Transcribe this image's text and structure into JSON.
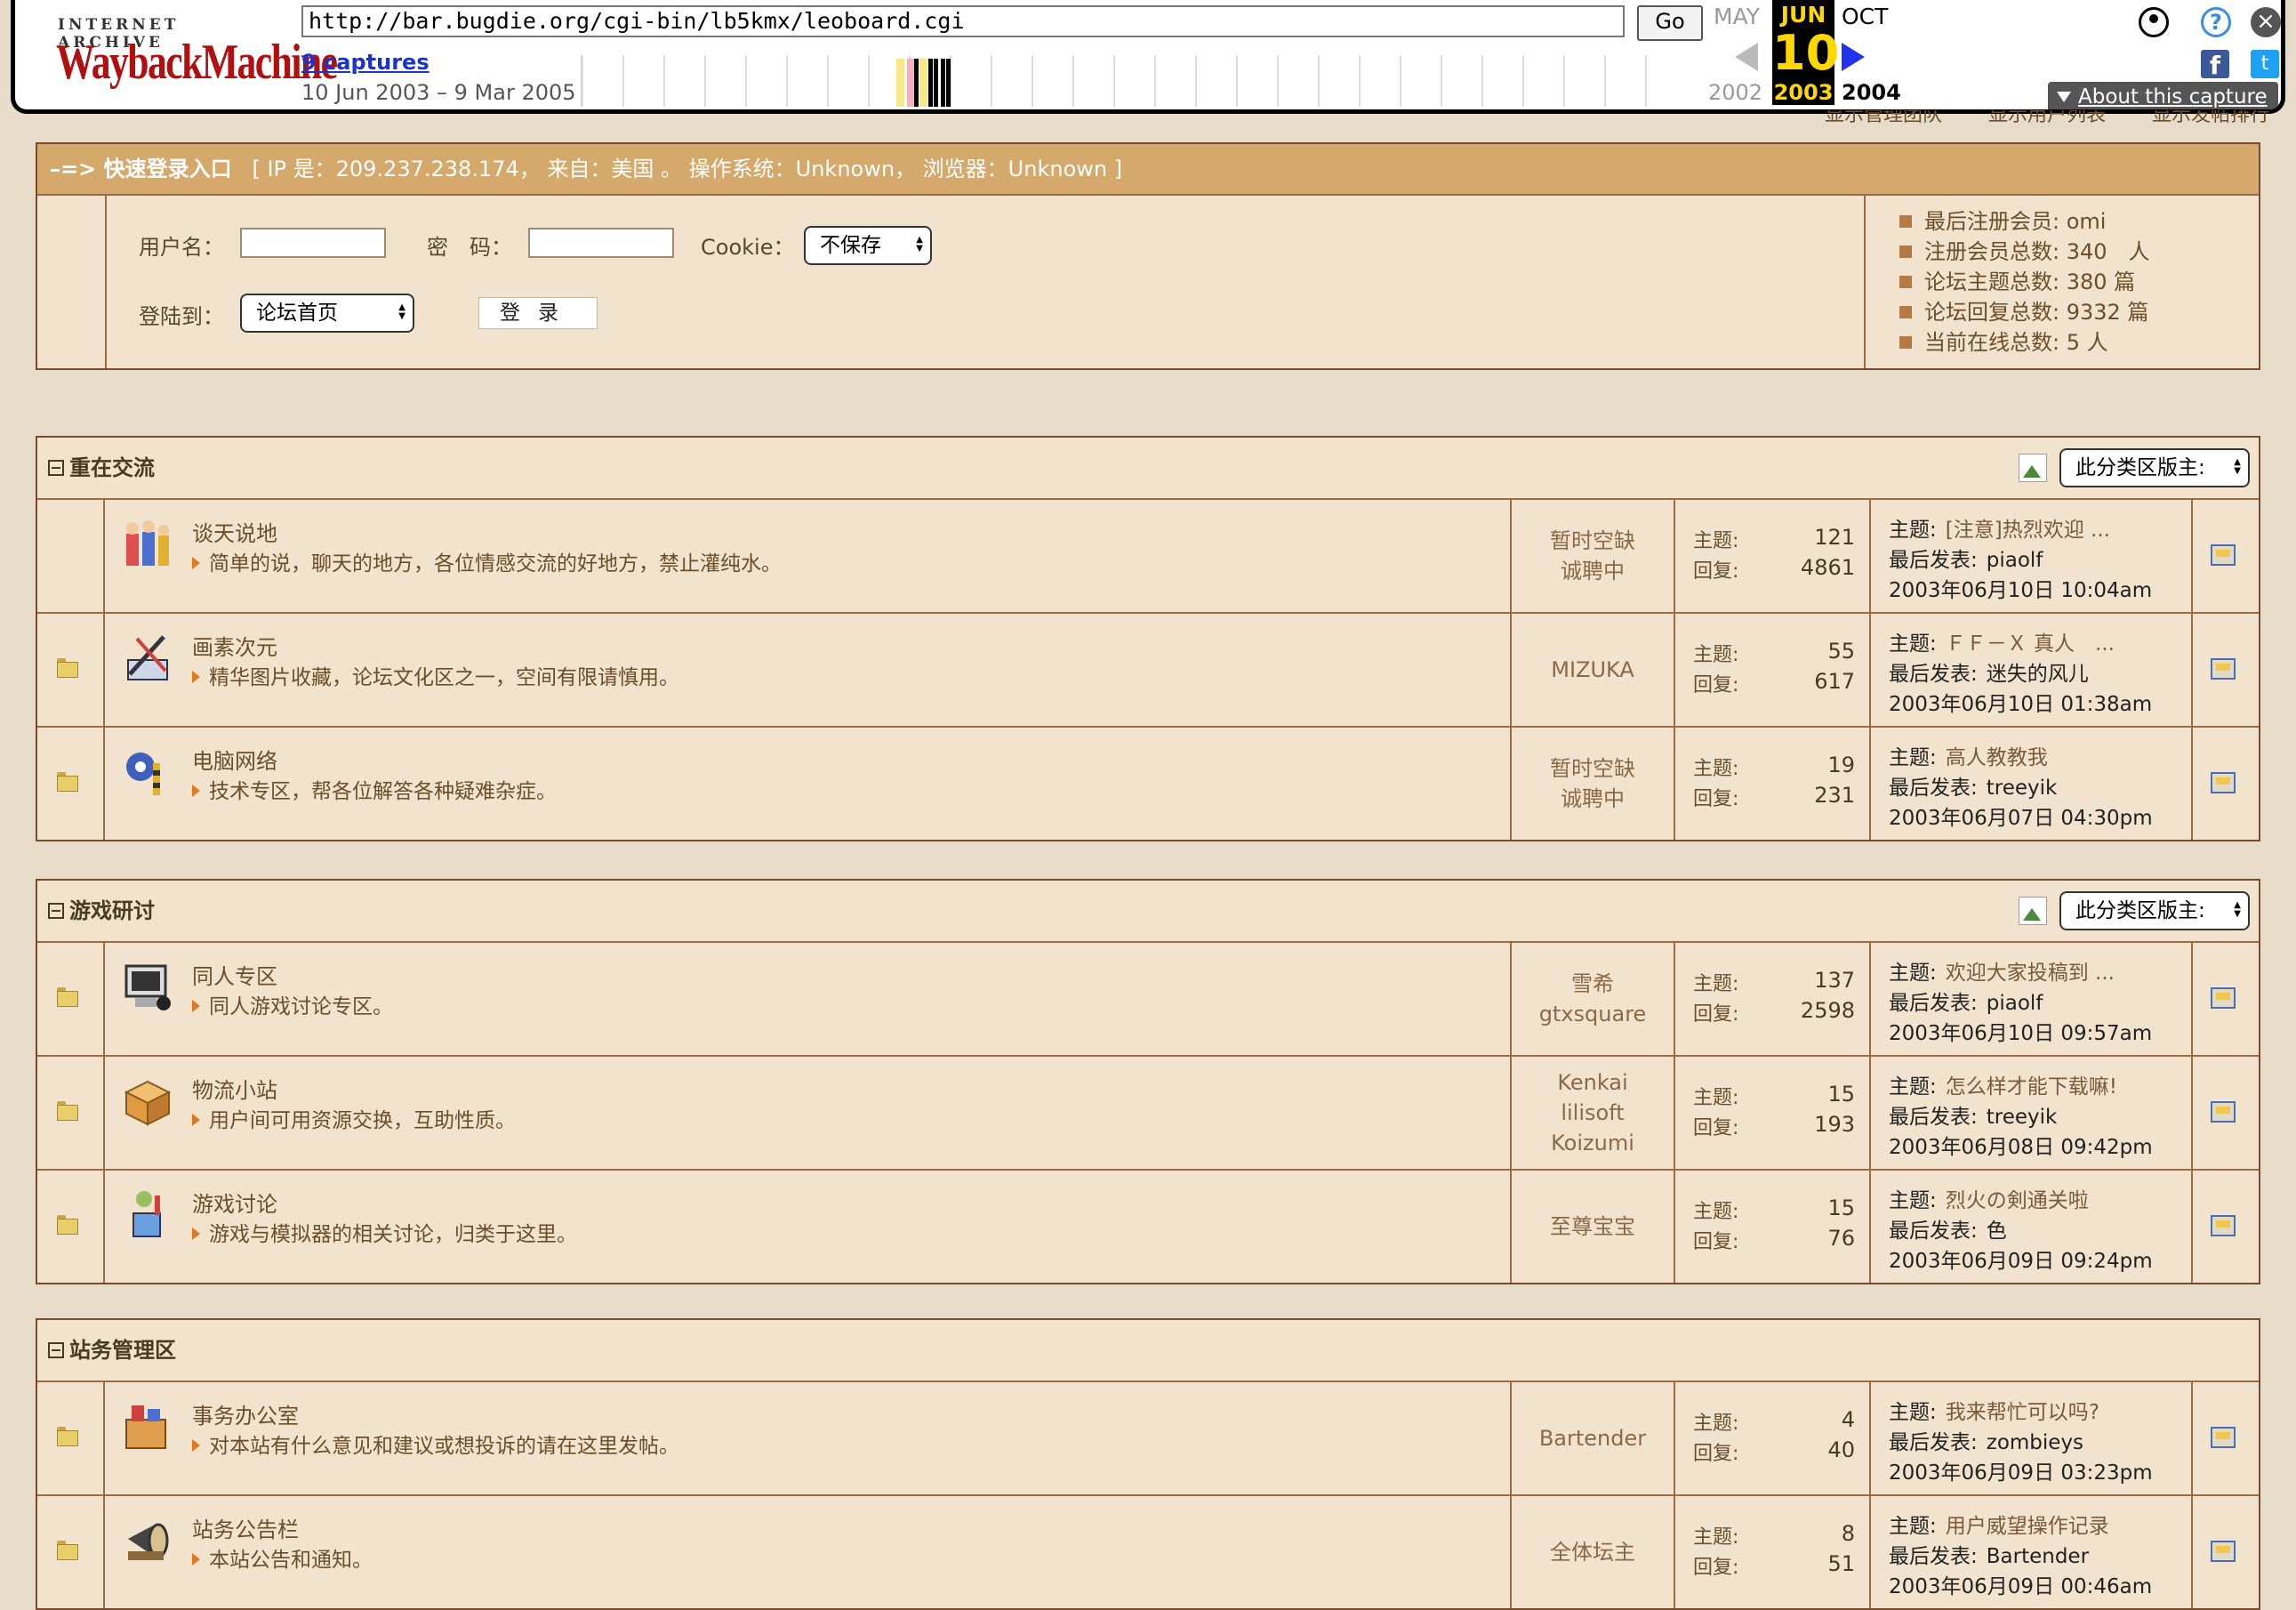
{
  "wayback": {
    "logo_top": "INTERNET ARCHIVE",
    "logo_main": "WaybackMachine",
    "url": "http://bar.bugdie.org/cgi-bin/lb5kmx/leoboard.cgi",
    "go_label": "Go",
    "captures": "9 captures",
    "range": "10 Jun 2003 – 9 Mar 2005",
    "prev_month": "MAY",
    "cur_month": "JUN",
    "next_month": "OCT",
    "day": "10",
    "prev_year": "2002",
    "cur_year": "2003",
    "next_year": "2004",
    "about": "About this capture",
    "icons": [
      "user-icon",
      "help-icon",
      "close-icon",
      "facebook-icon",
      "twitter-icon"
    ]
  },
  "under_links": [
    "显示管理团队",
    "显示用户列表",
    "显示发帖排行"
  ],
  "login": {
    "head_prefix": "–=> 快速登录入口",
    "head_info": "[ IP 是：209.237.238.174， 来自：美国 。  操作系统：Unknown， 浏览器：Unknown ]",
    "username_label": "用户名：",
    "password_label": "密　码：",
    "cookie_label": "Cookie：",
    "cookie_value": "不保存",
    "goto_label": "登陆到：",
    "goto_value": "论坛首页",
    "login_button": "登录"
  },
  "stats": [
    "最后注册会员: omi",
    "注册会员总数: 340　人",
    "论坛主题总数: 380 篇",
    "论坛回复总数: 9332 篇",
    "当前在线总数: 5 人"
  ],
  "labels": {
    "topic": "主题:",
    "reply": "回复:",
    "last_topic": "主题:",
    "last_post": "最后发表:",
    "moderator_select": "此分类区版主:"
  },
  "categories": [
    {
      "title": "重在交流",
      "forums": [
        {
          "name": "谈天说地",
          "desc": "简单的说，聊天的地方，各位情感交流的好地方，禁止灌纯水。",
          "mods": [
            "暂时空缺",
            "诚聘中"
          ],
          "topics": "121",
          "replies": "4861",
          "last_title": "[注意]热烈欢迎 ...",
          "last_user": "piaolf",
          "last_date": "2003年06月10日 10:04am",
          "icon": "people-icon"
        },
        {
          "name": "画素次元",
          "desc": "精华图片收藏，论坛文化区之一，空间有限请慎用。",
          "mods": [
            "MIZUKA"
          ],
          "topics": "55",
          "replies": "617",
          "last_title": "ＦＦ－Ｘ 真人　...",
          "last_user": "迷失的风儿",
          "last_date": "2003年06月10日 01:38am",
          "icon": "drawing-tools-icon"
        },
        {
          "name": "电脑网络",
          "desc": "技术专区，帮各位解答各种疑难杂症。",
          "mods": [
            "暂时空缺",
            "诚聘中"
          ],
          "topics": "19",
          "replies": "231",
          "last_title": "高人教教我",
          "last_user": "treeyik",
          "last_date": "2003年06月07日 04:30pm",
          "icon": "gear-tools-icon"
        }
      ]
    },
    {
      "title": "游戏研讨",
      "forums": [
        {
          "name": "同人专区",
          "desc": "同人游戏讨论专区。",
          "mods": [
            "雪希",
            "gtxsquare"
          ],
          "topics": "137",
          "replies": "2598",
          "last_title": "欢迎大家投稿到 ...",
          "last_user": "piaolf",
          "last_date": "2003年06月10日 09:57am",
          "icon": "computer-icon"
        },
        {
          "name": "物流小站",
          "desc": "用户间可用资源交换，互助性质。",
          "mods": [
            "Kenkai",
            "lilisoft",
            "Koizumi"
          ],
          "topics": "15",
          "replies": "193",
          "last_title": "怎么样才能下载嘛!",
          "last_user": "treeyik",
          "last_date": "2003年06月08日 09:42pm",
          "icon": "package-icon"
        },
        {
          "name": "游戏讨论",
          "desc": "游戏与模拟器的相关讨论，归类于这里。",
          "mods": [
            "至尊宝宝"
          ],
          "topics": "15",
          "replies": "76",
          "last_title": "烈火の剣通关啦",
          "last_user": "色",
          "last_date": "2003年06月09日 09:24pm",
          "icon": "game-icon"
        }
      ]
    },
    {
      "title": "站务管理区",
      "forums": [
        {
          "name": "事务办公室",
          "desc": "对本站有什么意见和建议或想投诉的请在这里发帖。",
          "mods": [
            "Bartender"
          ],
          "topics": "4",
          "replies": "40",
          "last_title": "我来帮忙可以吗?",
          "last_user": "zombieys",
          "last_date": "2003年06月09日 03:23pm",
          "icon": "office-box-icon"
        },
        {
          "name": "站务公告栏",
          "desc": "本站公告和通知。",
          "mods": [
            "全体坛主"
          ],
          "topics": "8",
          "replies": "51",
          "last_title": "用户威望操作记录",
          "last_user": "Bartender",
          "last_date": "2003年06月09日 00:46am",
          "icon": "megaphone-icon"
        }
      ]
    }
  ]
}
